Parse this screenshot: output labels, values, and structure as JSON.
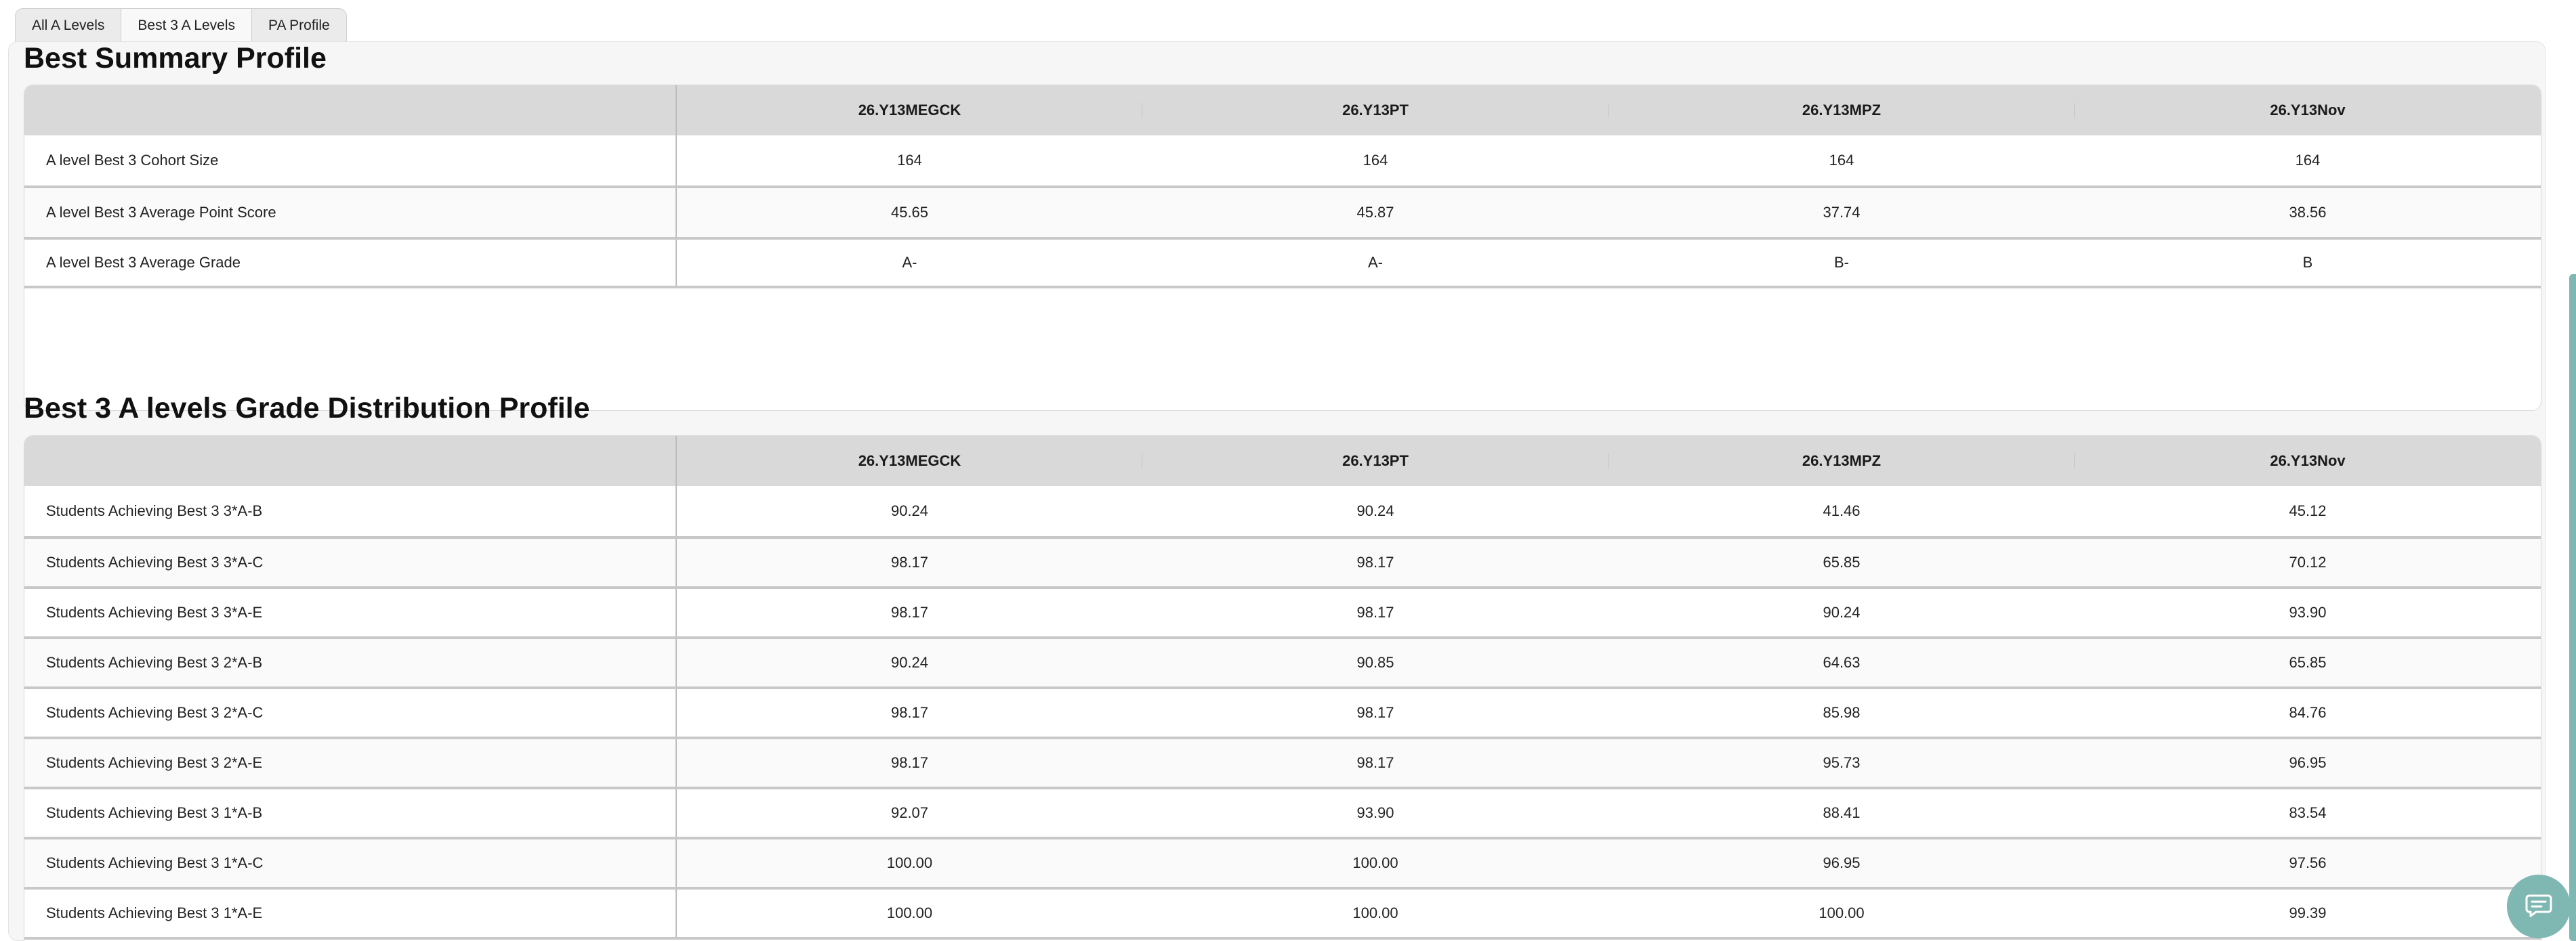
{
  "tabs": [
    {
      "label": "All A Levels",
      "active": false
    },
    {
      "label": "Best 3 A Levels",
      "active": true
    },
    {
      "label": "PA Profile",
      "active": false
    }
  ],
  "summary": {
    "title": "Best Summary Profile",
    "columns": [
      "",
      "26.Y13MEGCK",
      "26.Y13PT",
      "26.Y13MPZ",
      "26.Y13Nov"
    ],
    "rows": [
      {
        "label": "A level Best 3 Cohort Size",
        "values": [
          "164",
          "164",
          "164",
          "164"
        ]
      },
      {
        "label": "A level Best 3 Average Point Score",
        "values": [
          "45.65",
          "45.87",
          "37.74",
          "38.56"
        ]
      },
      {
        "label": "A level Best 3 Average Grade",
        "values": [
          "A-",
          "A-",
          "B-",
          "B"
        ]
      }
    ]
  },
  "distribution": {
    "title": "Best 3 A levels Grade Distribution Profile",
    "columns": [
      "",
      "26.Y13MEGCK",
      "26.Y13PT",
      "26.Y13MPZ",
      "26.Y13Nov"
    ],
    "rows": [
      {
        "label": "Students Achieving Best 3 3*A-B",
        "values": [
          "90.24",
          "90.24",
          "41.46",
          "45.12"
        ]
      },
      {
        "label": "Students Achieving Best 3 3*A-C",
        "values": [
          "98.17",
          "98.17",
          "65.85",
          "70.12"
        ]
      },
      {
        "label": "Students Achieving Best 3 3*A-E",
        "values": [
          "98.17",
          "98.17",
          "90.24",
          "93.90"
        ]
      },
      {
        "label": "Students Achieving Best 3 2*A-B",
        "values": [
          "90.24",
          "90.85",
          "64.63",
          "65.85"
        ]
      },
      {
        "label": "Students Achieving Best 3 2*A-C",
        "values": [
          "98.17",
          "98.17",
          "85.98",
          "84.76"
        ]
      },
      {
        "label": "Students Achieving Best 3 2*A-E",
        "values": [
          "98.17",
          "98.17",
          "95.73",
          "96.95"
        ]
      },
      {
        "label": "Students Achieving Best 3 1*A-B",
        "values": [
          "92.07",
          "93.90",
          "88.41",
          "83.54"
        ]
      },
      {
        "label": "Students Achieving Best 3 1*A-C",
        "values": [
          "100.00",
          "100.00",
          "96.95",
          "97.56"
        ]
      },
      {
        "label": "Students Achieving Best 3 1*A-E",
        "values": [
          "100.00",
          "100.00",
          "100.00",
          "99.39"
        ]
      }
    ]
  },
  "chat_button": {
    "icon": "chat-icon"
  },
  "colors": {
    "accent": "#7fb7b2",
    "header_bg": "#d8d9d8",
    "panel_bg": "#f6f6f6"
  }
}
